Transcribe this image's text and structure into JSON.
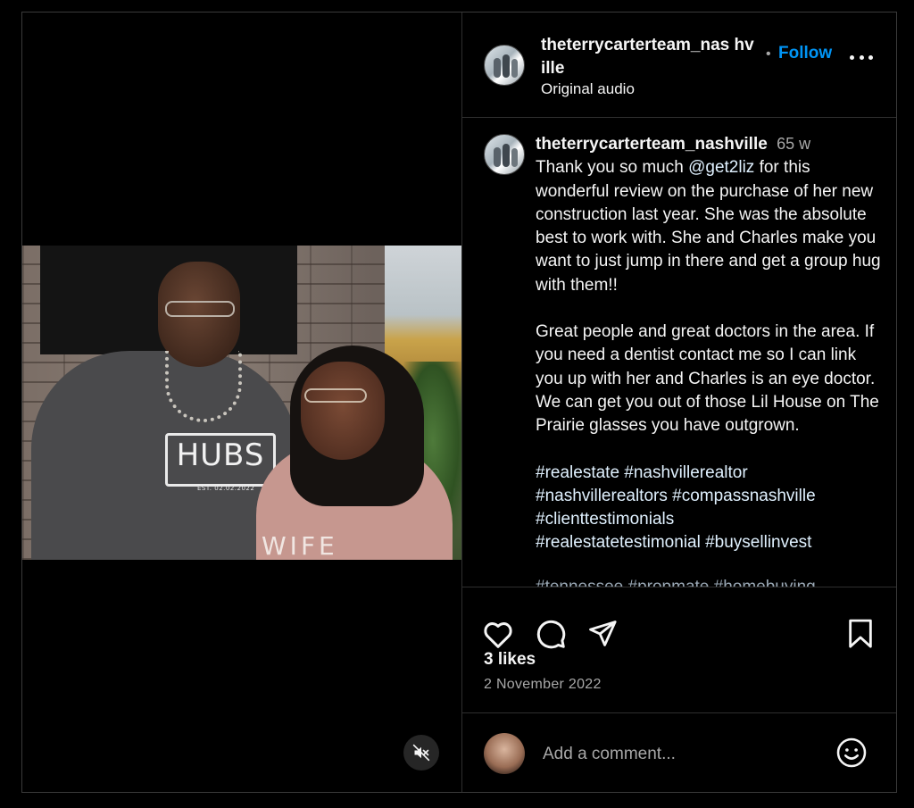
{
  "post": {
    "username": "theterrycarterteam_nashville",
    "username_header": "theterrycarterteam_nas hville",
    "audio": "Original audio",
    "follow_label": "Follow",
    "separator": "•"
  },
  "video": {
    "shirt_logo": "HUBS",
    "shirt_sub": "EST. 02.02.2022",
    "woman_shirt": "WIFE"
  },
  "caption": {
    "time": "65 w",
    "text_before_mention": "Thank you so much ",
    "mention": "@get2liz",
    "text_after_mention": " for this wonderful review on the purchase of her new construction last year. She was the absolute best to work with. She and Charles make you want to just jump in there and get a group hug with them!!",
    "paragraph2": "Great people and great doctors in the area. If you need a dentist contact me so I can link you up with her and Charles is an eye doctor. We can get you out of those Lil House on The Prairie glasses you have outgrown.",
    "hashtags": [
      "#realestate",
      "#nashvillerealtor",
      "#nashvillerealtors",
      "#compassnashville",
      "#clienttestimonials",
      "#realestatetestimonial",
      "#buysellinvest"
    ],
    "cut_line": "#tennessee #propmate #homebuying"
  },
  "stats": {
    "likes": "3 likes",
    "date": "2 November 2022"
  },
  "comment": {
    "placeholder": "Add a comment..."
  },
  "icons": {
    "like": "heart-icon",
    "comment": "comment-icon",
    "share": "share-icon",
    "save": "bookmark-icon",
    "more": "more-options-icon",
    "mute": "muted-speaker-icon",
    "emoji": "emoji-icon"
  },
  "colors": {
    "background": "#000000",
    "follow": "#0095f6",
    "secondary_text": "#a8a8a8",
    "link_text": "#e0f1ff",
    "divider": "#2f2f2f"
  }
}
